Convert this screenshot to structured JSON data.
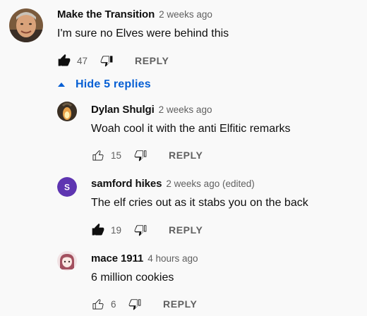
{
  "comments": [
    {
      "author": "Make the Transition",
      "time": "2 weeks ago",
      "text": "I'm sure no Elves were behind this",
      "likes": "47",
      "reply_label": "REPLY"
    }
  ],
  "replies_toggle": {
    "label": "Hide 5 replies",
    "icon": "caret-up-icon"
  },
  "replies": [
    {
      "author": "Dylan Shulgi",
      "time": "2 weeks ago",
      "text": "Woah cool it with the anti Elfitic remarks",
      "likes": "15",
      "reply_label": "REPLY"
    },
    {
      "author": "samford hikes",
      "time": "2 weeks ago (edited)",
      "text": "The elf cries out as it stabs you on the back",
      "likes": "19",
      "reply_label": "REPLY",
      "avatar_letter": "S",
      "avatar_color": "#5e35b1"
    },
    {
      "author": "mace 1911",
      "time": "4 hours ago",
      "text": "6 million cookies",
      "likes": "6",
      "reply_label": "REPLY"
    }
  ],
  "colors": {
    "link_blue": "#065fd4",
    "muted": "#606060",
    "background": "#f9f9f9"
  }
}
